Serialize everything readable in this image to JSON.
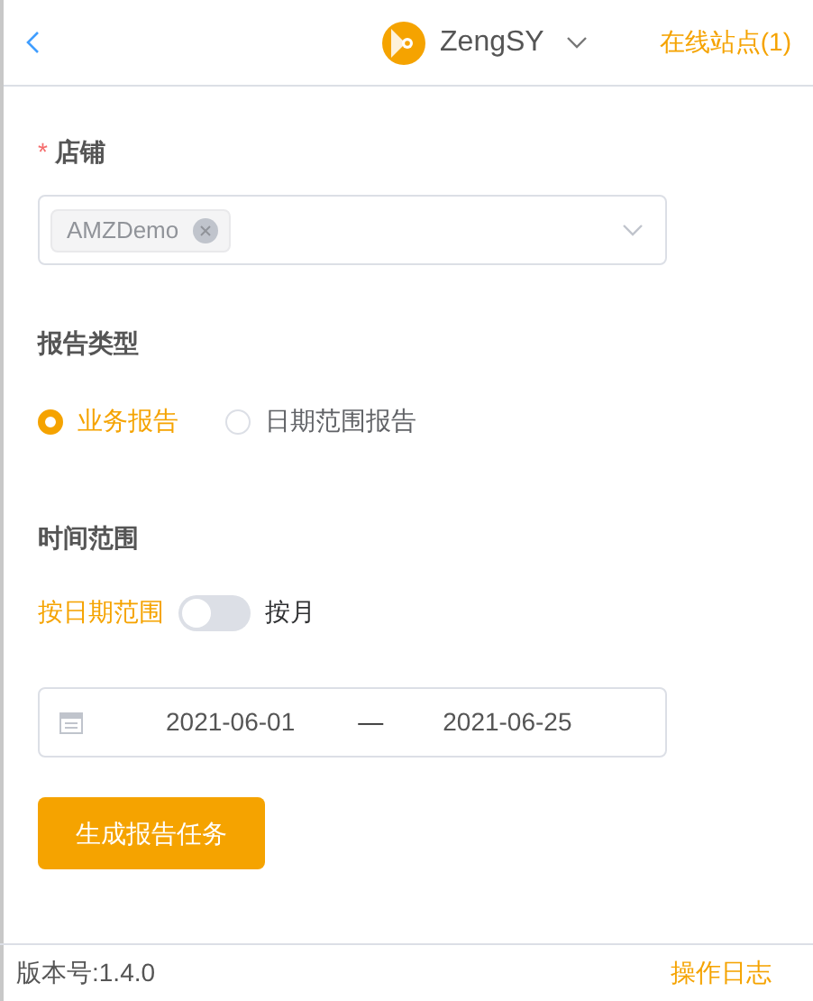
{
  "header": {
    "account": "ZengSY",
    "online_sites": "在线站点(1)"
  },
  "store": {
    "label": "店铺",
    "required_mark": "*",
    "tags": [
      {
        "text": "AMZDemo"
      }
    ]
  },
  "report_type": {
    "label": "报告类型",
    "options": [
      {
        "label": "业务报告",
        "selected": true
      },
      {
        "label": "日期范围报告",
        "selected": false
      }
    ]
  },
  "time_range": {
    "label": "时间范围",
    "toggle": {
      "left_label": "按日期范围",
      "right_label": "按月",
      "on": false
    },
    "date_range": {
      "start": "2021-06-01",
      "separator": "—",
      "end": "2021-06-25"
    }
  },
  "submit_button": "生成报告任务",
  "footer": {
    "version": "版本号:1.4.0",
    "log_link": "操作日志"
  }
}
